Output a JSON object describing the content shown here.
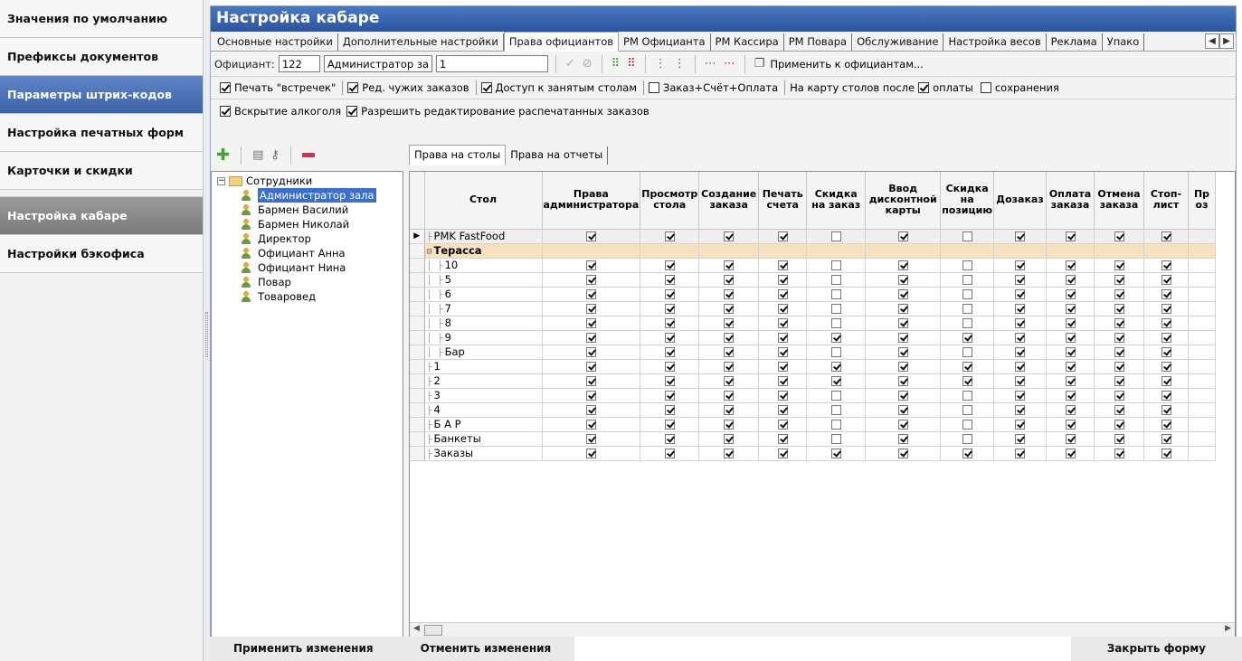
{
  "sidebar": {
    "items": [
      {
        "label": "Значения по умолчанию"
      },
      {
        "label": "Префиксы документов"
      },
      {
        "label": "Параметры штрих-кодов"
      },
      {
        "label": "Настройка печатных форм"
      },
      {
        "label": "Карточки и скидки"
      },
      {
        "label": "Настройка кабаре"
      },
      {
        "label": "Настройки бэкофиса"
      }
    ]
  },
  "window": {
    "title": "Настройка кабаре"
  },
  "tabs": [
    "Основные настройки",
    "Дополнительные настройки",
    "Права официантов",
    "РМ Официанта",
    "РМ Кассира",
    "РМ Повара",
    "Обслуживание",
    "Настройка весов",
    "Реклама",
    "Упако"
  ],
  "active_tab": "Права официантов",
  "toolbar": {
    "waiter_label": "Официант:",
    "waiter_code": "122",
    "waiter_name": "Администратор за",
    "waiter_extra": "1",
    "apply_label": "Применить к официантам..."
  },
  "options_row1": {
    "print_meetings": "Печать \"встречек\"",
    "edit_others": "Ред. чужих заказов",
    "busy_tables": "Доступ к занятым столам",
    "order_check_pay": "Заказ+Счёт+Оплата",
    "map_after": "На карту столов после",
    "payment": "оплаты",
    "saving": "сохранения"
  },
  "options_row2": {
    "alcohol": "Вскрытие алкоголя",
    "edit_printed": "Разрешить редактирование распечатанных заказов"
  },
  "tree": {
    "root": "Сотрудники",
    "employees": [
      "Администратор зала",
      "Бармен Василий",
      "Бармен Николай",
      "Директор",
      "Официант Анна",
      "Официант Нина",
      "Повар",
      "Товаровед"
    ],
    "selected": "Администратор зала"
  },
  "grid_tabs": [
    "Права на столы",
    "Права на отчеты"
  ],
  "grid": {
    "columns": [
      "Стол",
      "Права администратора",
      "Просмотр стола",
      "Создание заказа",
      "Печать счета",
      "Скидка на заказ",
      "Ввод дисконтной карты",
      "Скидка на позицию",
      "Дозаказ",
      "Оплата заказа",
      "Отмена заказа",
      "Стоп-лист",
      "Пр оз"
    ],
    "rows": [
      {
        "name": "PMK FastFood",
        "level": 0,
        "checks": [
          1,
          1,
          1,
          1,
          0,
          1,
          0,
          1,
          1,
          1,
          1
        ]
      },
      {
        "name": "Терасса",
        "level": 0,
        "group": true,
        "checks": []
      },
      {
        "name": "10",
        "level": 1,
        "checks": [
          1,
          1,
          1,
          1,
          0,
          1,
          0,
          1,
          1,
          1,
          1
        ]
      },
      {
        "name": "5",
        "level": 1,
        "checks": [
          1,
          1,
          1,
          1,
          0,
          1,
          0,
          1,
          1,
          1,
          1
        ]
      },
      {
        "name": "6",
        "level": 1,
        "checks": [
          1,
          1,
          1,
          1,
          0,
          1,
          0,
          1,
          1,
          1,
          1
        ]
      },
      {
        "name": "7",
        "level": 1,
        "checks": [
          1,
          1,
          1,
          1,
          0,
          1,
          0,
          1,
          1,
          1,
          1
        ]
      },
      {
        "name": "8",
        "level": 1,
        "checks": [
          1,
          1,
          1,
          1,
          0,
          1,
          0,
          1,
          1,
          1,
          1
        ]
      },
      {
        "name": "9",
        "level": 1,
        "checks": [
          1,
          1,
          1,
          1,
          1,
          1,
          1,
          1,
          1,
          1,
          1
        ]
      },
      {
        "name": "Бар",
        "level": 1,
        "checks": [
          1,
          1,
          1,
          1,
          0,
          1,
          0,
          1,
          1,
          1,
          1
        ]
      },
      {
        "name": "1",
        "level": 0,
        "checks": [
          1,
          1,
          1,
          1,
          1,
          1,
          1,
          1,
          1,
          1,
          1
        ]
      },
      {
        "name": "2",
        "level": 0,
        "checks": [
          1,
          1,
          1,
          1,
          1,
          1,
          1,
          1,
          1,
          1,
          1
        ]
      },
      {
        "name": "3",
        "level": 0,
        "checks": [
          1,
          1,
          1,
          1,
          0,
          1,
          0,
          1,
          1,
          1,
          1
        ]
      },
      {
        "name": "4",
        "level": 0,
        "checks": [
          1,
          1,
          1,
          1,
          0,
          1,
          0,
          1,
          1,
          1,
          1
        ]
      },
      {
        "name": "Б А Р",
        "level": 0,
        "checks": [
          1,
          1,
          1,
          1,
          0,
          1,
          0,
          1,
          1,
          1,
          1
        ]
      },
      {
        "name": "Банкеты",
        "level": 0,
        "checks": [
          1,
          1,
          1,
          1,
          0,
          1,
          0,
          1,
          1,
          1,
          1
        ]
      },
      {
        "name": "Заказы",
        "level": 0,
        "checks": [
          1,
          1,
          1,
          1,
          1,
          1,
          1,
          1,
          1,
          1,
          1
        ]
      }
    ]
  },
  "buttons": {
    "apply": "Применить изменения",
    "cancel": "Отменить изменения",
    "close": "Закрыть форму"
  }
}
